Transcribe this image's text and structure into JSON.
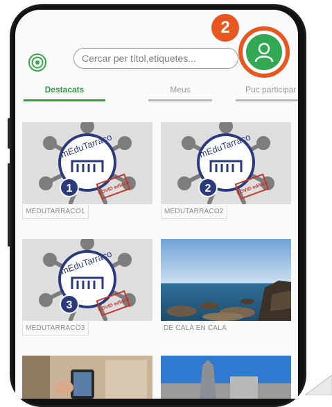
{
  "step_badge": "2",
  "search": {
    "placeholder": "Cercar per títol,etiquetes..."
  },
  "tabs": [
    {
      "label": "Destacats",
      "active": true
    },
    {
      "label": "Meus",
      "active": false
    },
    {
      "label": "Puc participar",
      "active": false
    }
  ],
  "cards": [
    {
      "caption": "MEDUTARRACO1",
      "logo_text": "mEduTarraco",
      "number": "1",
      "stamp": "COVID edition"
    },
    {
      "caption": "MEDUTARRACO2",
      "logo_text": "mEduTarraco",
      "number": "2",
      "stamp": "COVID edition"
    },
    {
      "caption": "MEDUTARRACO3",
      "logo_text": "mEduTarraco",
      "number": "3",
      "stamp": "COVID edition"
    },
    {
      "caption": "DE CALA EN CALA"
    }
  ],
  "colors": {
    "accent_green": "#2f9e44",
    "profile_green": "#33a852",
    "highlight_orange": "#e8571f"
  },
  "icons": {
    "logo": "concentric-circles-icon",
    "profile": "user-icon"
  }
}
